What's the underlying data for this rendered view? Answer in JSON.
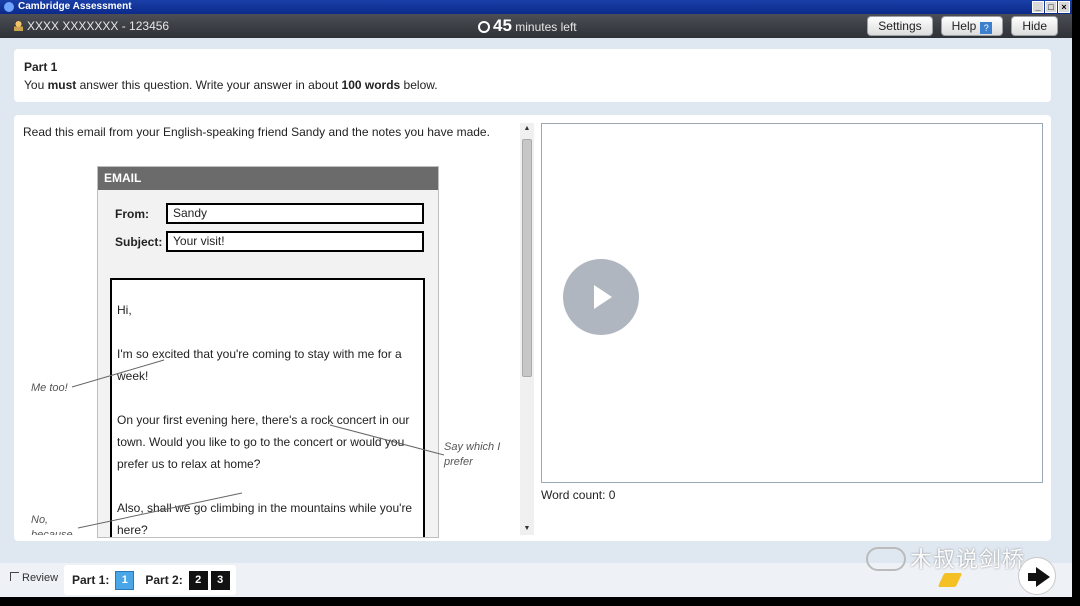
{
  "window": {
    "title": "Cambridge Assessment"
  },
  "topbar": {
    "candidate": "XXXX XXXXXXX - 123456",
    "timer_value": "45",
    "timer_suffix": "minutes left",
    "settings_label": "Settings",
    "help_label": "Help",
    "help_badge": "?",
    "hide_label": "Hide"
  },
  "instructions": {
    "part_title": "Part 1",
    "text_before_must": "You ",
    "must": "must",
    "text_middle": " answer this question. Write your answer in about ",
    "word_target": "100 words",
    "text_after": " below."
  },
  "question": {
    "lead": "Read this email from your English-speaking friend Sandy and the notes you have made.",
    "email_header": "EMAIL",
    "from_label": "From:",
    "from_value": "Sandy",
    "subject_label": "Subject:",
    "subject_value": "Your visit!",
    "body": [
      "Hi,",
      "I'm so excited that you're coming to stay with me for a week!",
      "On your first evening here, there's a rock concert in our town. Would you like to go to the concert or would you prefer us to relax at home?",
      "Also, shall we go climbing in the mountains while you're here?"
    ],
    "notes": {
      "me_too": "Me too!",
      "say_which": "Say which I prefer",
      "no_because": "No, because"
    }
  },
  "answer": {
    "word_count_label": "Word count: 0"
  },
  "bottom": {
    "review_label": "Review",
    "part1_label": "Part 1:",
    "part1_questions": [
      "1"
    ],
    "part2_label": "Part 2:",
    "part2_questions": [
      "2",
      "3"
    ]
  },
  "watermark": "木叔说剑桥",
  "colors": {
    "title_bar": "#0c2a8a",
    "top_bar": "#3a3d42",
    "active_question": "#4aa6e6",
    "background": "#dfe7f1"
  }
}
